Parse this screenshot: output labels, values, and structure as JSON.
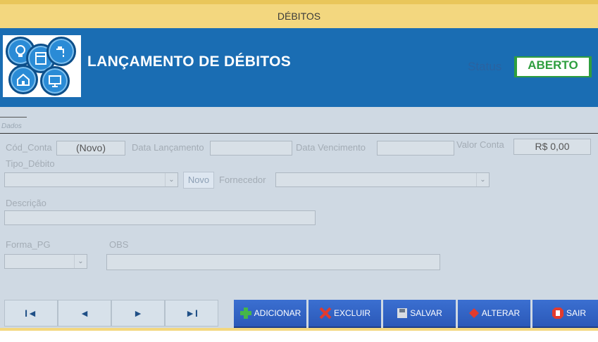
{
  "window": {
    "title": "DÉBITOS"
  },
  "header": {
    "title": "LANÇAMENTO DE DÉBITOS",
    "status_label": "Status",
    "status_value": "ABERTO",
    "logo_icons": [
      "lightbulb-icon",
      "appliance-icon",
      "faucet-icon",
      "house-icon",
      "monitor-icon"
    ]
  },
  "tab": {
    "label": "Dados"
  },
  "form": {
    "cod_conta": {
      "label": "Cód_Conta",
      "value": "(Novo)"
    },
    "data_lancamento": {
      "label": "Data Lançamento",
      "value": ""
    },
    "data_vencimento": {
      "label": "Data Vencimento",
      "value": ""
    },
    "valor_conta": {
      "label": "Valor Conta",
      "value": "R$ 0,00"
    },
    "tipo_debito": {
      "label": "Tipo_Débito",
      "value": ""
    },
    "novo_button": "Novo",
    "fornecedor": {
      "label": "Fornecedor",
      "value": ""
    },
    "descricao": {
      "label": "Descrição",
      "value": ""
    },
    "forma_pg": {
      "label": "Forma_PG",
      "value": ""
    },
    "obs": {
      "label": "OBS",
      "value": ""
    }
  },
  "navigation": {
    "first": "I◄",
    "prev": "◄",
    "next": "►",
    "last": "►I"
  },
  "actions": {
    "adicionar": "ADICIONAR",
    "excluir": "EXCLUIR",
    "salvar": "SALVAR",
    "alterar": "ALTERAR",
    "sair": "SAIR"
  },
  "colors": {
    "title_bar": "#f3d77f",
    "header": "#1a6db3",
    "form_bg": "#cfd9e3",
    "status": "#2e9e3e",
    "action_button": "#3565c8"
  }
}
